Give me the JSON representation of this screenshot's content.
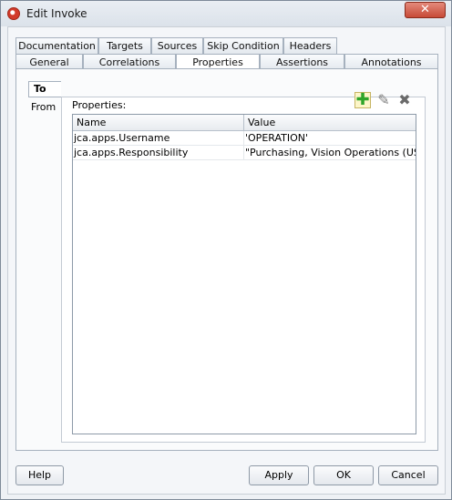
{
  "window": {
    "title": "Edit Invoke",
    "close_glyph": "✕"
  },
  "tabs_row1": [
    "Documentation",
    "Targets",
    "Sources",
    "Skip Condition",
    "Headers"
  ],
  "tabs_row2": [
    "General",
    "Correlations",
    "Properties",
    "Assertions",
    "Annotations"
  ],
  "active_tab": "Properties",
  "side_tabs": {
    "to": "To",
    "from": "From"
  },
  "properties": {
    "label": "Properties:",
    "toolbar": {
      "add_icon": "plus-icon",
      "edit_icon": "pencil-icon",
      "delete_icon": "cross-icon"
    },
    "columns": [
      "Name",
      "Value"
    ],
    "rows": [
      {
        "name": "jca.apps.Username",
        "value": "'OPERATION'"
      },
      {
        "name": "jca.apps.Responsibility",
        "value": "\"Purchasing, Vision Operations (USA)'"
      }
    ]
  },
  "buttons": {
    "help": "Help",
    "apply": "Apply",
    "ok": "OK",
    "cancel": "Cancel"
  }
}
